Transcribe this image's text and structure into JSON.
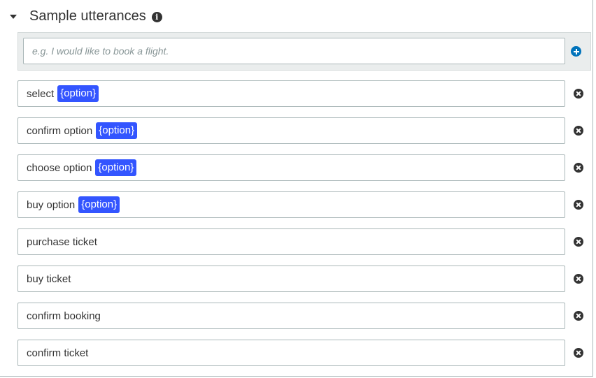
{
  "section": {
    "title": "Sample utterances",
    "caret_icon": "caret-down-icon",
    "info_icon": "info-icon"
  },
  "new_utterance": {
    "placeholder": "e.g. I would like to book a flight.",
    "value": "",
    "add_icon": "plus-circle-icon"
  },
  "utterances": [
    {
      "text": "select",
      "slot": "{option}"
    },
    {
      "text": "confirm option",
      "slot": "{option}"
    },
    {
      "text": "choose option",
      "slot": "{option}"
    },
    {
      "text": "buy option",
      "slot": "{option}"
    },
    {
      "text": "purchase ticket"
    },
    {
      "text": "buy ticket"
    },
    {
      "text": "confirm booking"
    },
    {
      "text": "confirm ticket"
    }
  ],
  "remove_icon": "remove-circle-icon",
  "colors": {
    "slot_chip": "#3355ff",
    "add_icon": "#0073bb",
    "remove_icon": "#333333",
    "new_row_background": "#eaeded"
  }
}
